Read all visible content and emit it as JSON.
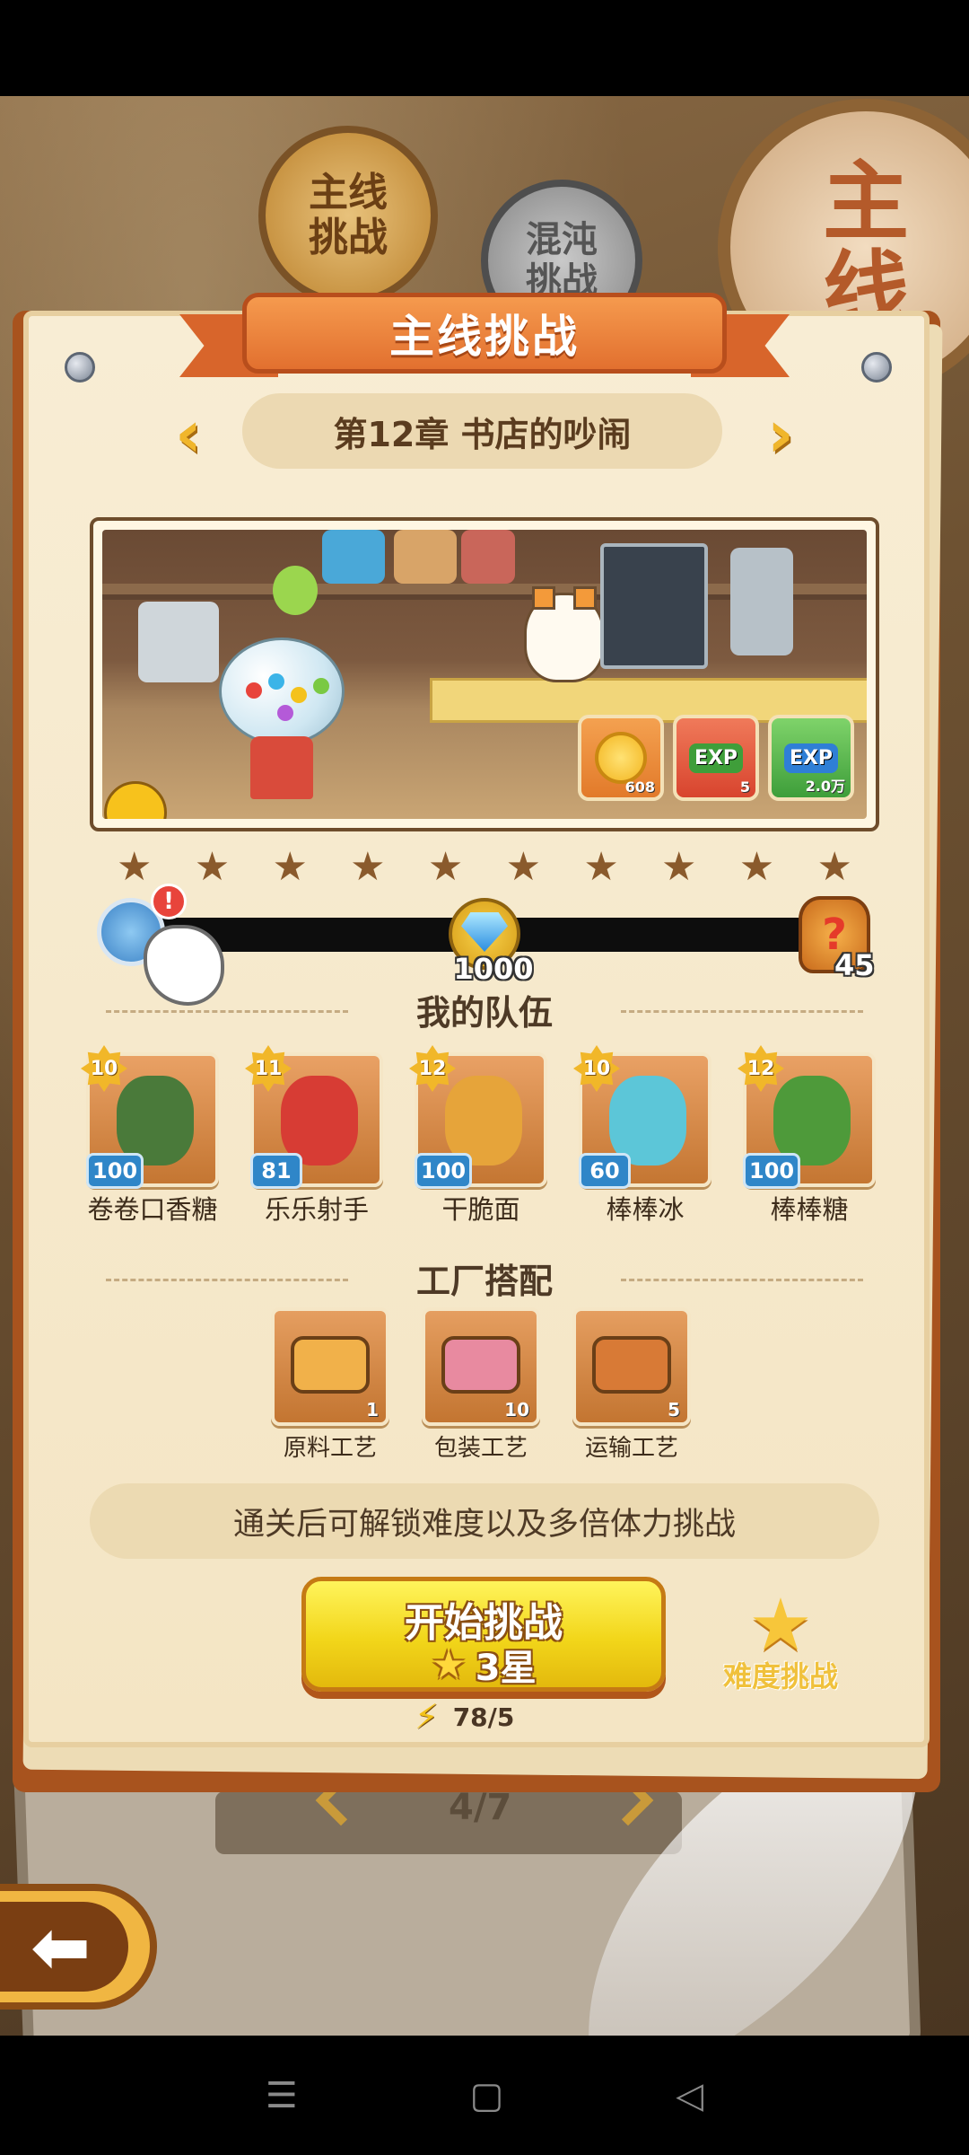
{
  "tabs": {
    "main_line": "主线\n挑战",
    "chaos": "混沌\n挑战",
    "big_coin": "主\n线"
  },
  "banner_title": "主线挑战",
  "chapter": {
    "title": "第12章 书店的吵闹",
    "prev_symbol": "‹",
    "next_symbol": "›"
  },
  "rewards": [
    {
      "name": "coin-reward",
      "count": "608",
      "label": ""
    },
    {
      "name": "exp-reward-red",
      "count": "5",
      "label": "EXP"
    },
    {
      "name": "exp-reward-blue",
      "count": "2.0万",
      "label": "EXP"
    }
  ],
  "stars_count": 10,
  "progress": {
    "alert": "!",
    "milestone_value": "1000",
    "end_symbol": "?",
    "end_value": "45",
    "fill_fraction": 0
  },
  "team": {
    "title": "我的队伍",
    "members": [
      {
        "name": "卷卷口香糖",
        "level": "10",
        "power": "100",
        "color": "#4a7a3a"
      },
      {
        "name": "乐乐射手",
        "level": "11",
        "power": "81",
        "color": "#d73c34"
      },
      {
        "name": "干脆面",
        "level": "12",
        "power": "100",
        "color": "#e6a43a"
      },
      {
        "name": "棒棒冰",
        "level": "10",
        "power": "60",
        "color": "#5cc6d8"
      },
      {
        "name": "棒棒糖",
        "level": "12",
        "power": "100",
        "color": "#4e9a3a"
      }
    ]
  },
  "factory": {
    "title": "工厂搭配",
    "items": [
      {
        "name": "原料工艺",
        "count": "1",
        "color": "#f1b14a"
      },
      {
        "name": "包装工艺",
        "count": "10",
        "color": "#e88aa0"
      },
      {
        "name": "运输工艺",
        "count": "5",
        "color": "#d87a36"
      }
    ]
  },
  "unlock_hint": "通关后可解锁难度以及多倍体力挑战",
  "start_button": {
    "label": "开始挑战",
    "stars": "3星",
    "star_symbol": "★"
  },
  "energy": {
    "value": "78/5",
    "symbol": "⚡"
  },
  "difficulty_button": {
    "label": "难度挑战",
    "symbol": "★"
  },
  "background": {
    "page_indicator": "4/7"
  },
  "back_symbol": "⬅",
  "nav": {
    "menu": "☰",
    "home": "▢",
    "back": "◁"
  }
}
